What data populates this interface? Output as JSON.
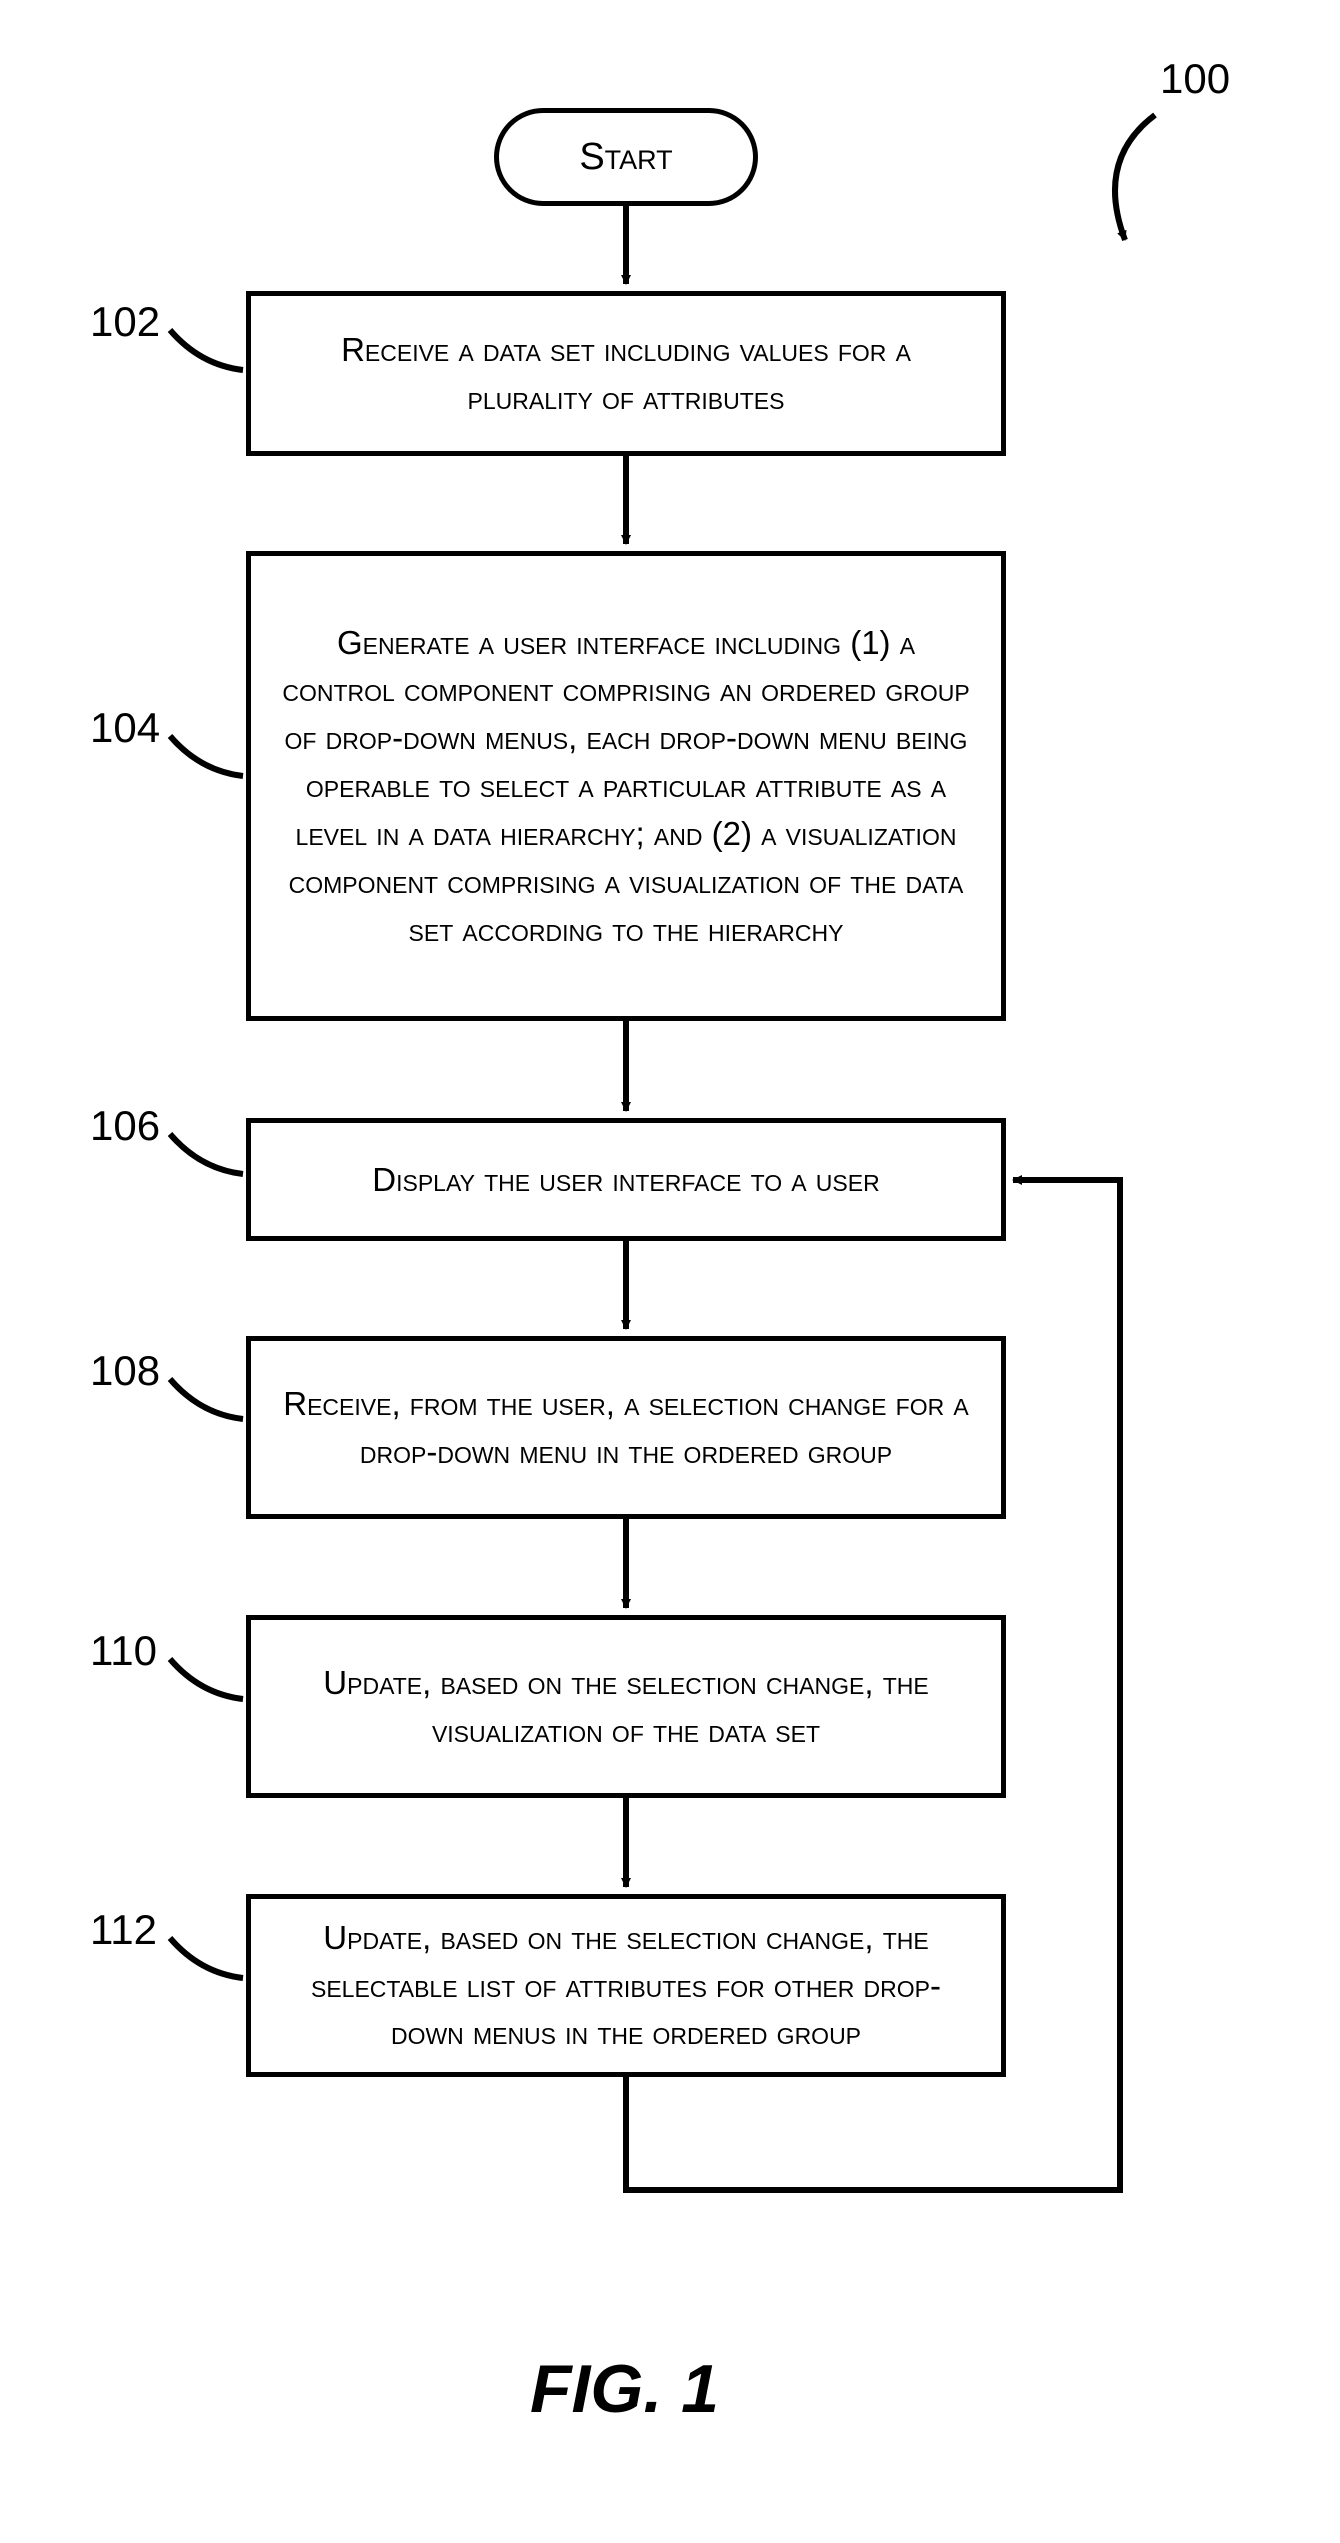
{
  "diagram": {
    "figure_label": "FIG. 1",
    "overall_ref": "100",
    "start_label": "Start",
    "steps": [
      {
        "ref": "102",
        "text": "Receive a data set including values for a plurality of attributes"
      },
      {
        "ref": "104",
        "text": "Generate a user interface including (1) a control component comprising an ordered group of drop-down menus, each drop-down menu being operable to select a particular attribute as a level in a data hierarchy; and (2) a visualization component comprising a visualization of the data set according to the hierarchy"
      },
      {
        "ref": "106",
        "text": "Display the user interface to a user"
      },
      {
        "ref": "108",
        "text": "Receive, from the user, a selection change for a drop-down menu in the ordered group"
      },
      {
        "ref": "110",
        "text": "Update, based on the selection change, the visualization of the data set"
      },
      {
        "ref": "112",
        "text": "Update, based on the selection change, the selectable list of attributes for other drop-down menus in the ordered group"
      }
    ]
  }
}
